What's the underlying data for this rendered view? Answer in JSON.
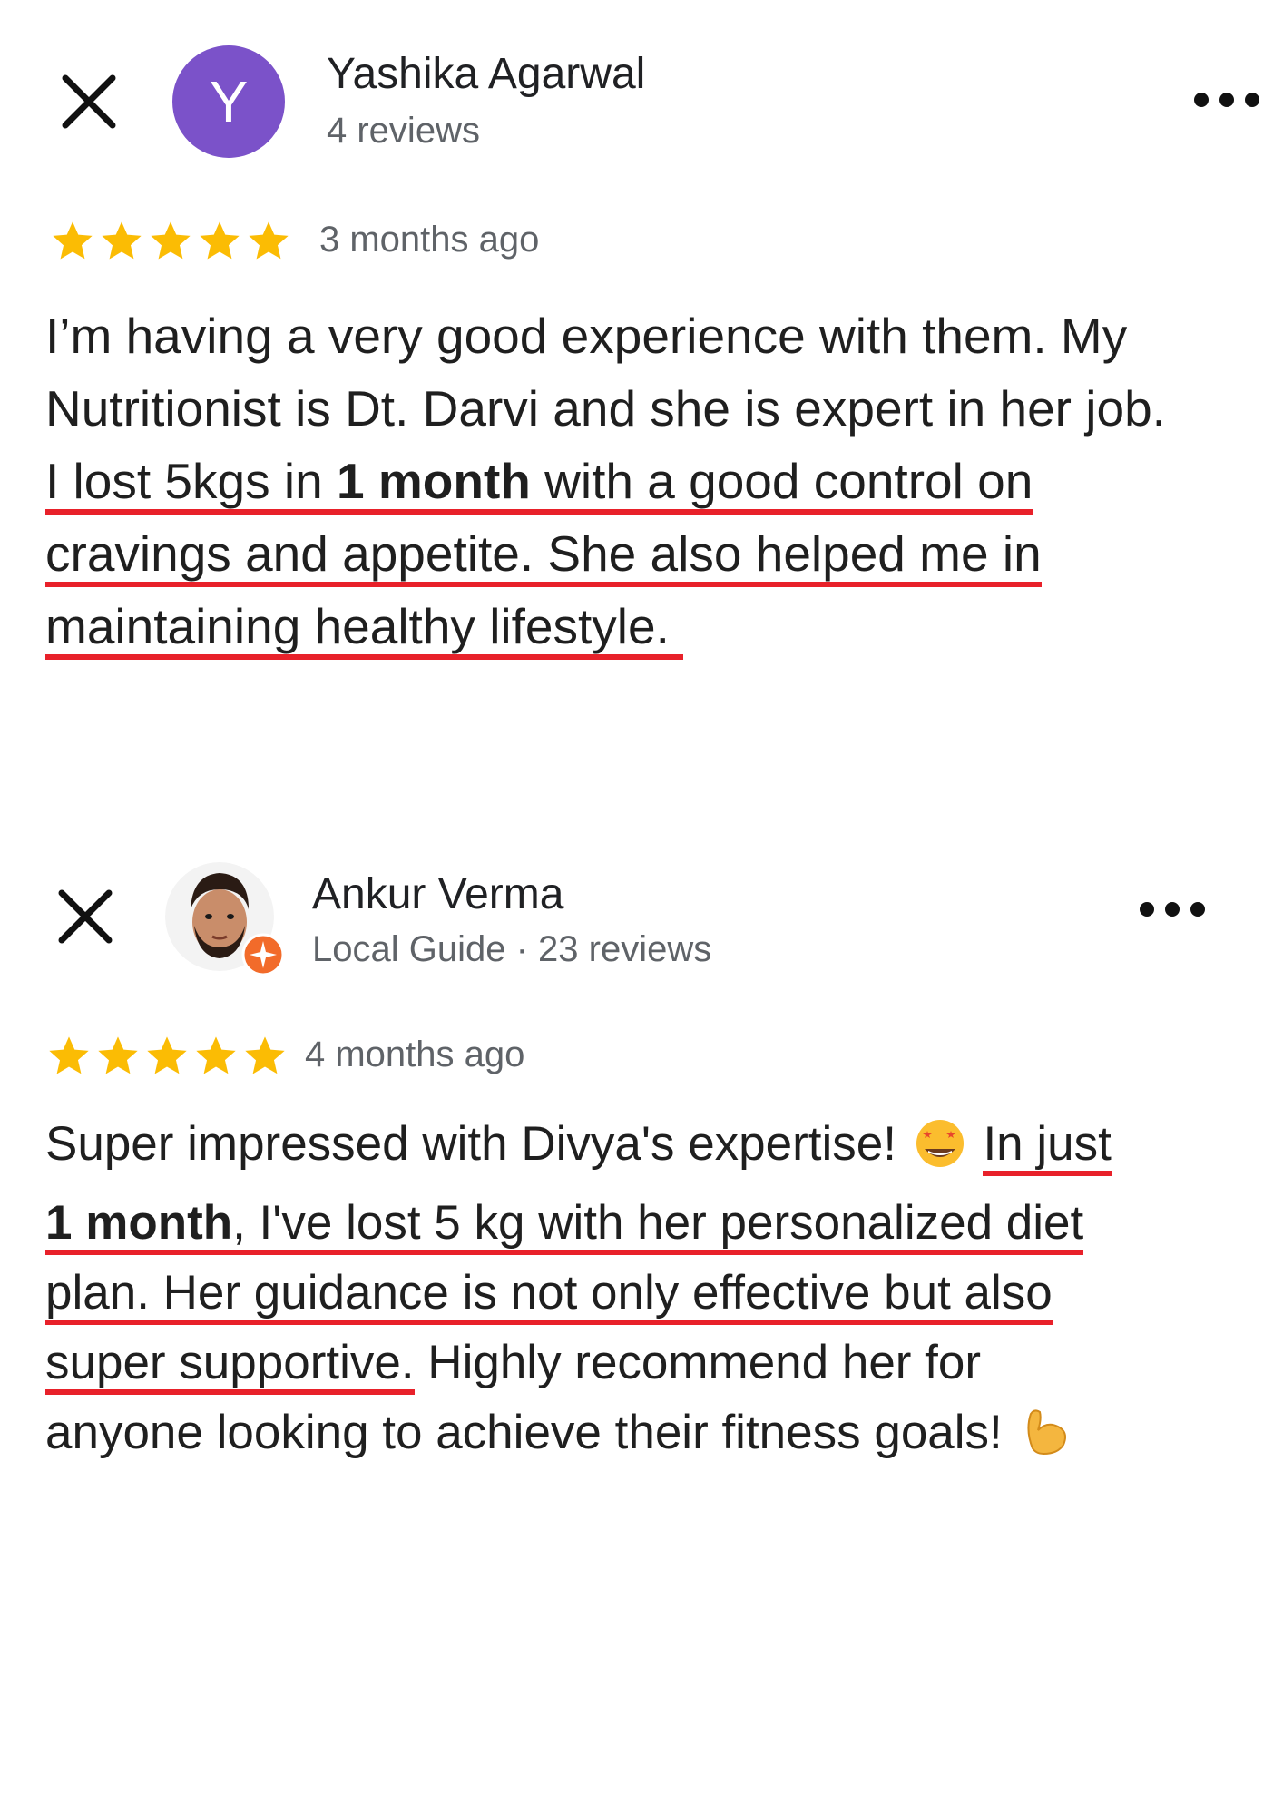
{
  "reviews": [
    {
      "reviewer": {
        "name": "Yashika Agarwal",
        "meta": "4 reviews",
        "avatar_letter": "Y",
        "avatar_color": "#7b52c9"
      },
      "rating": 5,
      "date": "3 months ago",
      "text": {
        "l1": "I’m having a very good experience with them. My",
        "l2": "Nutritionist is Dt. Darvi and she is expert in her job.",
        "l3a": "I lost 5kgs in ",
        "l3b": "1 month",
        "l3c": " with a good control on",
        "l4": "cravings and appetite. She also helped me in",
        "l5": "maintaining healthy lifestyle. "
      }
    },
    {
      "reviewer": {
        "name": "Ankur Verma",
        "meta": "Local Guide · 23 reviews",
        "badge_icon": "local-guide-star-icon"
      },
      "rating": 5,
      "date": "4 months ago",
      "text": {
        "l1a": "Super impressed with Divya's expertise! ",
        "l1b": "In just",
        "l2a": "1 month",
        "l2b": ", I've lost 5 kg with her personalized diet",
        "l3": "plan. Her guidance is not only effective but also",
        "l4a": "super supportive.",
        "l4b": " Highly recommend her for",
        "l5": "anyone looking to achieve their fitness goals! "
      }
    }
  ],
  "colors": {
    "star": "#fbbc04",
    "underline": "#e8212a",
    "guide_badge": "#f26b2a"
  },
  "icons": {
    "close": "close-icon",
    "more": "more-options-icon",
    "emoji1": "star-struck-emoji",
    "emoji2": "flexed-biceps-emoji"
  }
}
